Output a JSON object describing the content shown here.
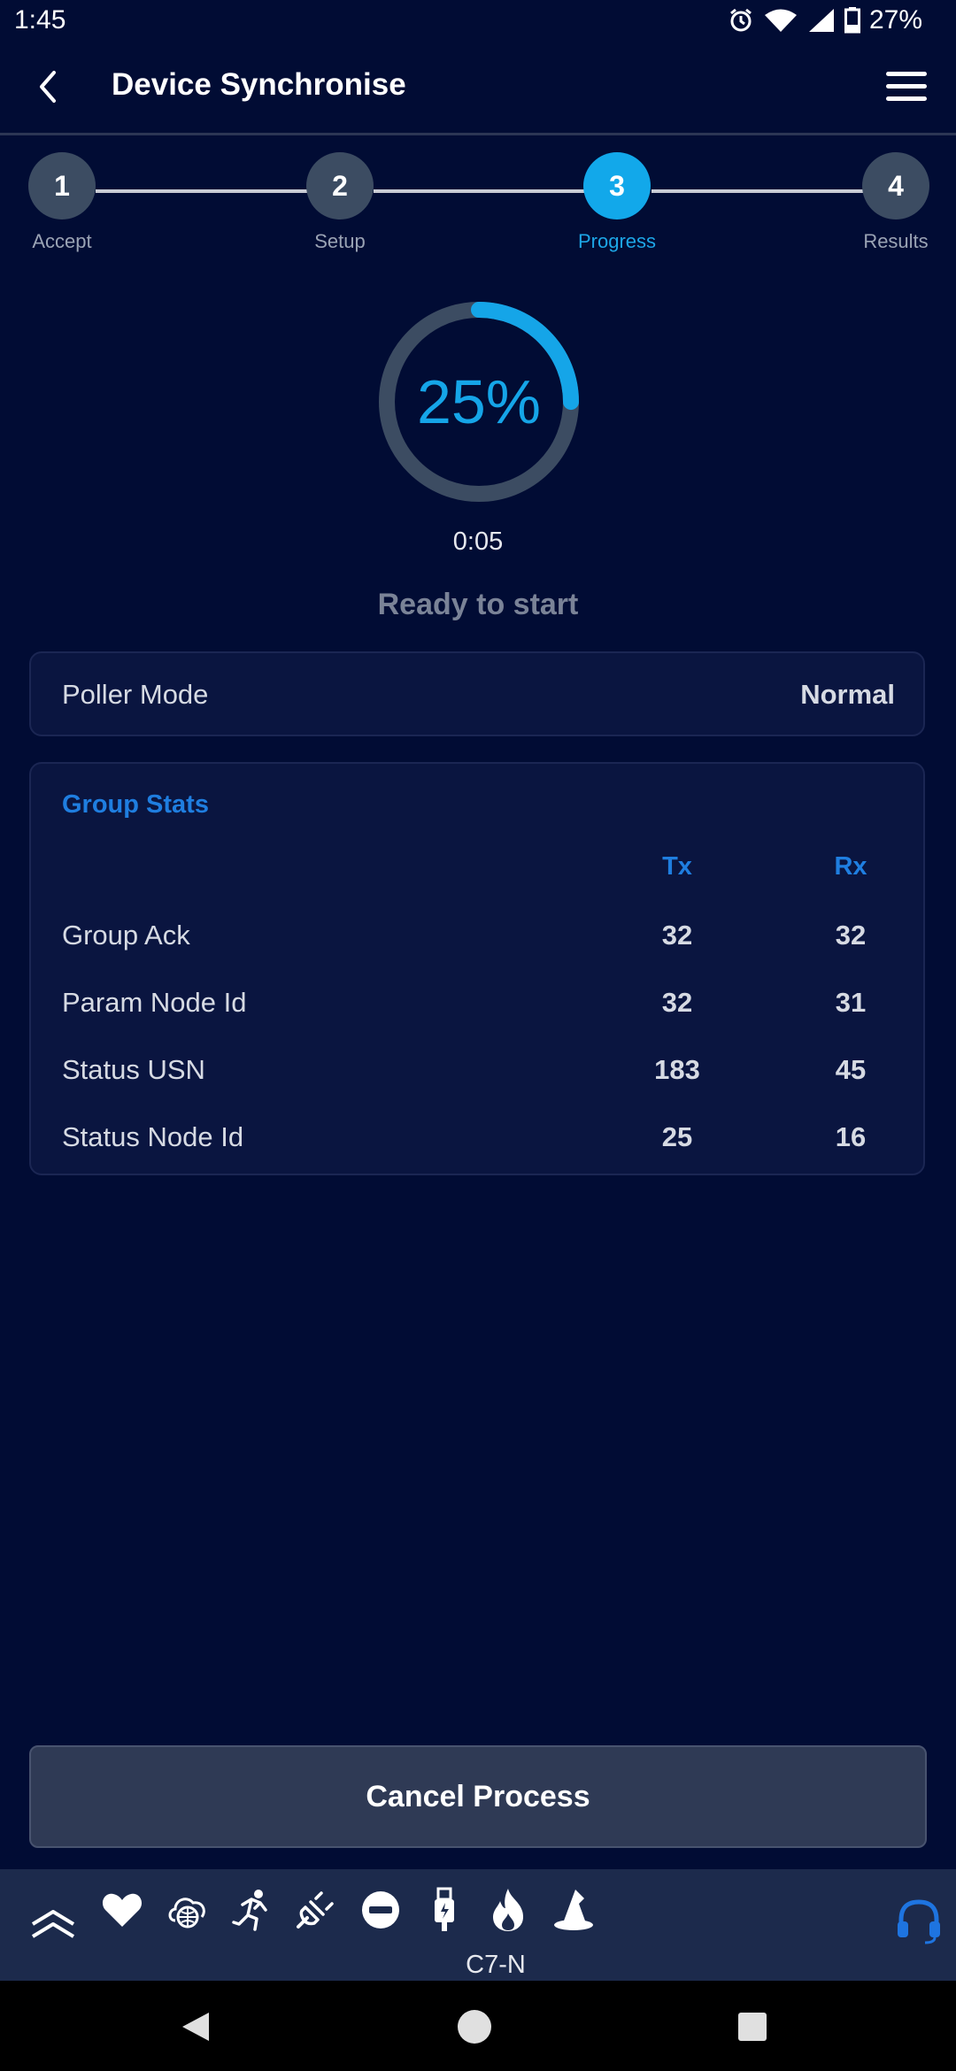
{
  "status_bar": {
    "time": "1:45",
    "battery": "27%",
    "icons": [
      "alarm-icon",
      "wifi-icon",
      "signal-icon",
      "battery-icon"
    ]
  },
  "header": {
    "title": "Device Synchronise",
    "back_icon": "chevron-left-icon",
    "menu_icon": "hamburger-menu-icon"
  },
  "stepper": {
    "steps": [
      {
        "number": "1",
        "label": "Accept"
      },
      {
        "number": "2",
        "label": "Setup"
      },
      {
        "number": "3",
        "label": "Progress"
      },
      {
        "number": "4",
        "label": "Results"
      }
    ],
    "active_step": 3
  },
  "progress": {
    "percent_text": "25%",
    "fraction": 0.25,
    "elapsed": "0:05",
    "status": "Ready to start",
    "colors": {
      "ring_fill": "#15a5e8",
      "ring_track": "#3c4c62"
    }
  },
  "poller": {
    "label": "Poller Mode",
    "value": "Normal"
  },
  "group_stats": {
    "title": "Group Stats",
    "columns": {
      "tx": "Tx",
      "rx": "Rx"
    },
    "rows": [
      {
        "name": "Group Ack",
        "tx": "32",
        "rx": "32"
      },
      {
        "name": "Param Node Id",
        "tx": "32",
        "rx": "31"
      },
      {
        "name": "Status USN",
        "tx": "183",
        "rx": "45"
      },
      {
        "name": "Status Node Id",
        "tx": "25",
        "rx": "16"
      }
    ]
  },
  "cancel_button": {
    "label": "Cancel Process"
  },
  "toolbar": {
    "device": "C7-N",
    "icons": [
      "chevrons-up-icon",
      "heart-icon",
      "cloud-globe-icon",
      "running-person-icon",
      "plug-icon",
      "minus-circle-icon",
      "usb-icon",
      "flame-icon",
      "wizard-hat-icon",
      "headset-icon"
    ]
  },
  "nav_bar": {
    "icons": [
      "back-triangle-icon",
      "home-circle-icon",
      "recents-square-icon"
    ]
  }
}
